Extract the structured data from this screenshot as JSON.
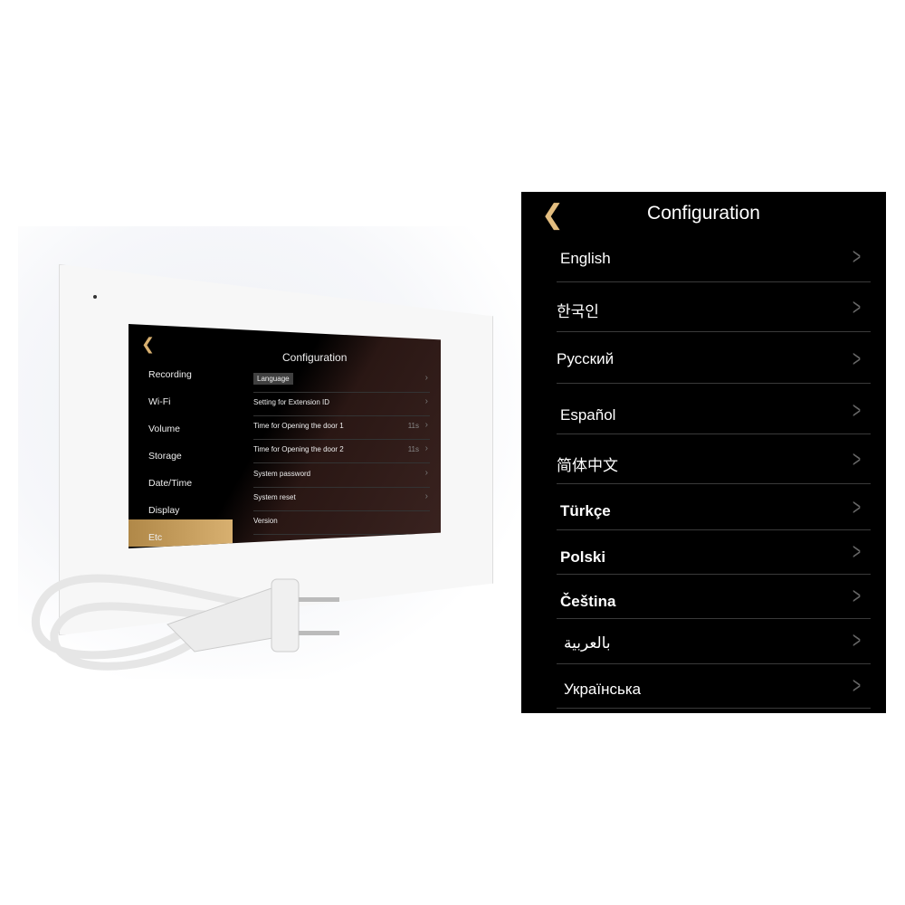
{
  "device": {
    "title": "Configuration",
    "sidebar": [
      "Recording",
      "Wi-Fi",
      "Volume",
      "Storage",
      "Date/Time",
      "Display",
      "Etc"
    ],
    "items": [
      {
        "label": "Language",
        "value": ""
      },
      {
        "label": "Setting for Extension ID",
        "value": ""
      },
      {
        "label": "Time for Opening the door 1",
        "value": "11s"
      },
      {
        "label": "Time for Opening the door 2",
        "value": "11s"
      },
      {
        "label": "System  password",
        "value": ""
      },
      {
        "label": "System reset",
        "value": ""
      },
      {
        "label": "Version",
        "value": ""
      }
    ]
  },
  "panel": {
    "title": "Configuration",
    "languages": [
      "English",
      "한국인",
      "Русский",
      "Español",
      "简体中文",
      "Türkçe",
      "Polski",
      "Čeština",
      "بالعربية",
      "Українська"
    ]
  },
  "colors": {
    "accent": "#d8b070",
    "background": "#000000"
  }
}
